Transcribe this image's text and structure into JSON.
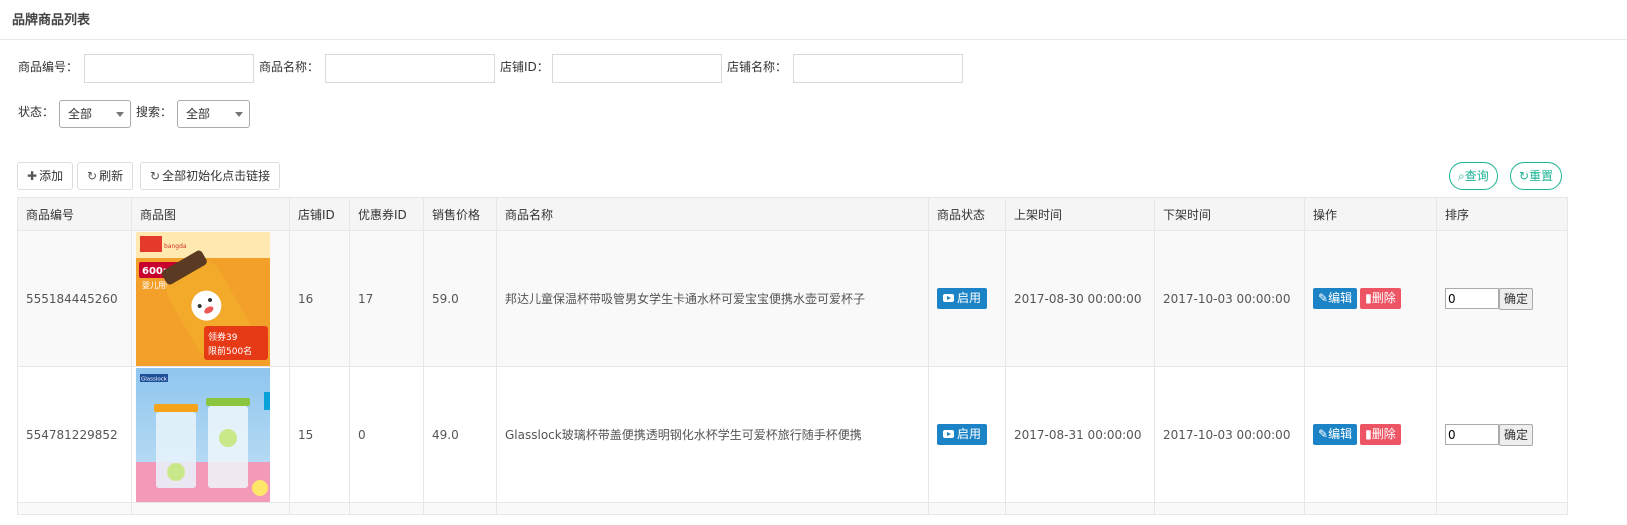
{
  "page": {
    "title": "品牌商品列表"
  },
  "filters": {
    "goods_no_label": "商品编号：",
    "goods_name_label": "商品名称：",
    "shop_id_label": "店铺ID：",
    "shop_name_label": "店铺名称：",
    "status_label": "状态：",
    "status_value": "全部",
    "search_label": "搜索：",
    "search_value": "全部"
  },
  "toolbar": {
    "add_label": "添加",
    "refresh_label": "刷新",
    "init_label": "全部初始化点击链接",
    "query_label": "查询",
    "reset_label": "重置"
  },
  "table": {
    "headers": [
      "商品编号",
      "商品图",
      "店铺ID",
      "优惠券ID",
      "销售价格",
      "商品名称",
      "商品状态",
      "上架时间",
      "下架时间",
      "操作",
      "排序"
    ],
    "rows": [
      {
        "goods_no": "555184445260",
        "img_text": {
          "brand": "bangda",
          "cap": "600ml容量",
          "sub": "婴儿用吸管",
          "coupon": "领券39",
          "limit": "限前500名"
        },
        "shop_id": "16",
        "coupon_id": "17",
        "price": "59.0",
        "name": "邦达儿童保温杯带吸管男女学生卡通水杯可爱宝宝便携水壶可爱杯子",
        "status": "启用",
        "on_time": "2017-08-30 00:00:00",
        "off_time": "2017-10-03 00:00:00",
        "edit": "编辑",
        "delete": "删除",
        "sort": "0",
        "confirm": "确定"
      },
      {
        "goods_no": "554781229852",
        "img_text": {
          "brand": "Glasslock"
        },
        "shop_id": "15",
        "coupon_id": "0",
        "price": "49.0",
        "name": "Glasslock玻璃杯带盖便携透明钢化水杯学生可爱杯旅行随手杯便携",
        "status": "启用",
        "on_time": "2017-08-31 00:00:00",
        "off_time": "2017-10-03 00:00:00",
        "edit": "编辑",
        "delete": "删除",
        "sort": "0",
        "confirm": "确定"
      }
    ]
  },
  "colors": {
    "primary": "#1c84c6",
    "danger": "#ed5565",
    "accent": "#1ab394"
  },
  "icons": [
    "plus-icon",
    "refresh-icon",
    "search-icon",
    "reset-icon",
    "play-icon",
    "edit-icon",
    "trash-icon"
  ]
}
